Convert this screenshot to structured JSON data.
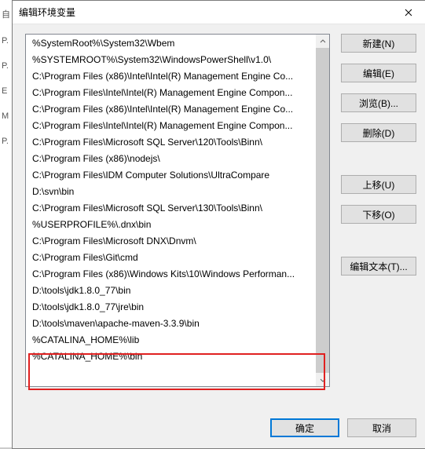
{
  "window": {
    "title": "编辑环境变量"
  },
  "items": [
    "%SystemRoot%\\System32\\Wbem",
    "%SYSTEMROOT%\\System32\\WindowsPowerShell\\v1.0\\",
    "C:\\Program Files (x86)\\Intel\\Intel(R) Management Engine Co...",
    "C:\\Program Files\\Intel\\Intel(R) Management Engine Compon...",
    "C:\\Program Files (x86)\\Intel\\Intel(R) Management Engine Co...",
    "C:\\Program Files\\Intel\\Intel(R) Management Engine Compon...",
    "C:\\Program Files\\Microsoft SQL Server\\120\\Tools\\Binn\\",
    "C:\\Program Files (x86)\\nodejs\\",
    "C:\\Program Files\\IDM Computer Solutions\\UltraCompare",
    "D:\\svn\\bin",
    "C:\\Program Files\\Microsoft SQL Server\\130\\Tools\\Binn\\",
    "%USERPROFILE%\\.dnx\\bin",
    "C:\\Program Files\\Microsoft DNX\\Dnvm\\",
    "C:\\Program Files\\Git\\cmd",
    "C:\\Program Files (x86)\\Windows Kits\\10\\Windows Performan...",
    "D:\\tools\\jdk1.8.0_77\\bin",
    "D:\\tools\\jdk1.8.0_77\\jre\\bin",
    "D:\\tools\\maven\\apache-maven-3.3.9\\bin",
    "%CATALINA_HOME%\\lib",
    "%CATALINA_HOME%\\bin"
  ],
  "buttons": {
    "new": "新建(N)",
    "edit": "编辑(E)",
    "browse": "浏览(B)...",
    "delete": "删除(D)",
    "moveUp": "上移(U)",
    "moveDown": "下移(O)",
    "editText": "编辑文本(T)..."
  },
  "footer": {
    "ok": "确定",
    "cancel": "取消"
  }
}
